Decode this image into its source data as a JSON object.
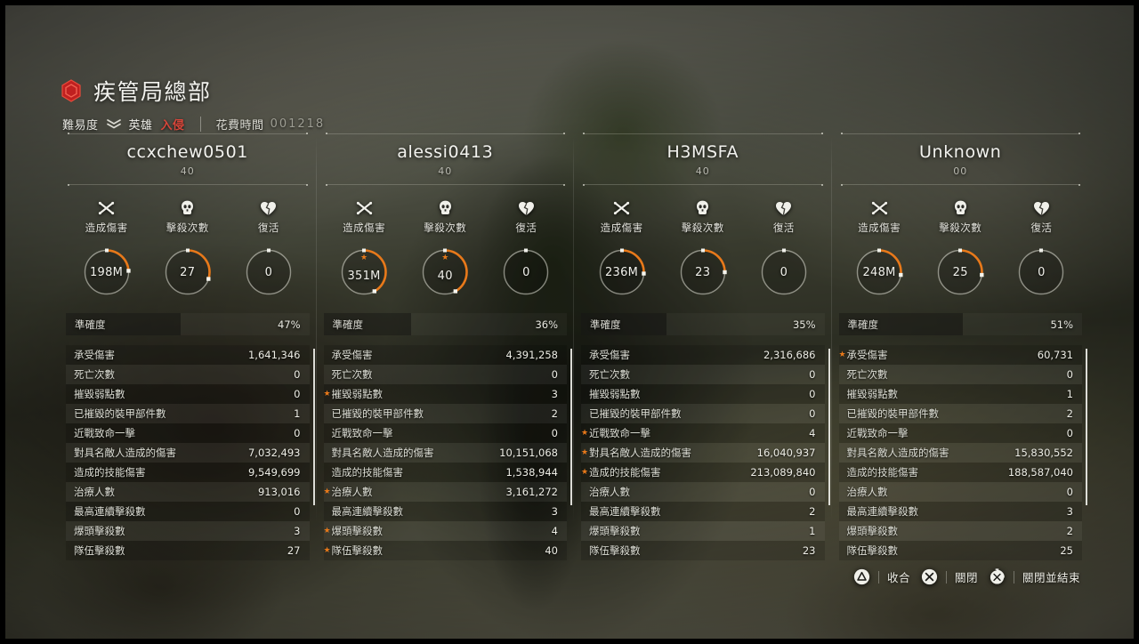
{
  "header": {
    "icon": "hexagon-icon",
    "title": "疾管局總部",
    "difficulty_label": "難易度",
    "difficulty_icon": "chevrons-down-icon",
    "difficulty_name": "英雄",
    "difficulty_modifier": "入侵",
    "time_label": "花費時間",
    "time_value": "001218"
  },
  "colors": {
    "accent_orange": "#e8791a",
    "modifier_red": "#d8463a",
    "text_primary": "#f0f0ea",
    "text_secondary": "#b9b9b0"
  },
  "circle_stats_labels": [
    "造成傷害",
    "擊殺次數",
    "復活"
  ],
  "circle_stats_icons": [
    "crossed-swords-icon",
    "skull-icon",
    "broken-heart-icon"
  ],
  "accuracy_label": "準確度",
  "stat_labels": [
    "承受傷害",
    "死亡次數",
    "摧毀弱點數",
    "已摧毀的裝甲部件數",
    "近戰致命一擊",
    "對具名敵人造成的傷害",
    "造成的技能傷害",
    "治療人數",
    "最高連續擊殺數",
    "爆頭擊殺數",
    "隊伍擊殺數"
  ],
  "players": [
    {
      "name": "ccxchew0501",
      "level": "40",
      "circles": [
        {
          "value": "198M",
          "pct": 24,
          "star": false
        },
        {
          "value": "27",
          "pct": 30,
          "star": false
        },
        {
          "value": "0",
          "pct": 0,
          "star": false
        }
      ],
      "accuracy": "47%",
      "accuracy_pct": 47,
      "stats": [
        {
          "value": "1,641,346",
          "star": false
        },
        {
          "value": "0",
          "star": false
        },
        {
          "value": "0",
          "star": false
        },
        {
          "value": "1",
          "star": false
        },
        {
          "value": "0",
          "star": false
        },
        {
          "value": "7,032,493",
          "star": false
        },
        {
          "value": "9,549,699",
          "star": false
        },
        {
          "value": "913,016",
          "star": false
        },
        {
          "value": "0",
          "star": false
        },
        {
          "value": "3",
          "star": false
        },
        {
          "value": "27",
          "star": false
        }
      ]
    },
    {
      "name": "alessi0413",
      "level": "40",
      "circles": [
        {
          "value": "351M",
          "pct": 42,
          "star": true
        },
        {
          "value": "40",
          "pct": 42,
          "star": true
        },
        {
          "value": "0",
          "pct": 0,
          "star": false
        }
      ],
      "accuracy": "36%",
      "accuracy_pct": 36,
      "stats": [
        {
          "value": "4,391,258",
          "star": false
        },
        {
          "value": "0",
          "star": false
        },
        {
          "value": "3",
          "star": true
        },
        {
          "value": "2",
          "star": false
        },
        {
          "value": "0",
          "star": false
        },
        {
          "value": "10,151,068",
          "star": false
        },
        {
          "value": "1,538,944",
          "star": false
        },
        {
          "value": "3,161,272",
          "star": true
        },
        {
          "value": "3",
          "star": false
        },
        {
          "value": "4",
          "star": true
        },
        {
          "value": "40",
          "star": true
        }
      ]
    },
    {
      "name": "H3MSFA",
      "level": "40",
      "circles": [
        {
          "value": "236M",
          "pct": 26,
          "star": false
        },
        {
          "value": "23",
          "pct": 25,
          "star": false
        },
        {
          "value": "0",
          "pct": 0,
          "star": false
        }
      ],
      "accuracy": "35%",
      "accuracy_pct": 35,
      "stats": [
        {
          "value": "2,316,686",
          "star": false
        },
        {
          "value": "0",
          "star": false
        },
        {
          "value": "0",
          "star": false
        },
        {
          "value": "0",
          "star": false
        },
        {
          "value": "4",
          "star": true
        },
        {
          "value": "16,040,937",
          "star": true
        },
        {
          "value": "213,089,840",
          "star": true
        },
        {
          "value": "0",
          "star": false
        },
        {
          "value": "2",
          "star": false
        },
        {
          "value": "1",
          "star": false
        },
        {
          "value": "23",
          "star": false
        }
      ]
    },
    {
      "name": "Unknown",
      "level": "00",
      "circles": [
        {
          "value": "248M",
          "pct": 27,
          "star": false
        },
        {
          "value": "25",
          "pct": 27,
          "star": false
        },
        {
          "value": "0",
          "pct": 0,
          "star": false
        }
      ],
      "accuracy": "51%",
      "accuracy_pct": 51,
      "stats": [
        {
          "value": "60,731",
          "star": true
        },
        {
          "value": "0",
          "star": false
        },
        {
          "value": "1",
          "star": false
        },
        {
          "value": "2",
          "star": false
        },
        {
          "value": "0",
          "star": false
        },
        {
          "value": "15,830,552",
          "star": false
        },
        {
          "value": "188,587,040",
          "star": false
        },
        {
          "value": "0",
          "star": false
        },
        {
          "value": "3",
          "star": false
        },
        {
          "value": "2",
          "star": false
        },
        {
          "value": "25",
          "star": false
        }
      ]
    }
  ],
  "footer_prompts": [
    {
      "icon": "playstation-triangle-icon",
      "label": "收合"
    },
    {
      "icon": "playstation-cross-icon",
      "label": "關閉"
    },
    {
      "icon": "playstation-cross-hold-icon",
      "label": "關閉並結束"
    }
  ]
}
